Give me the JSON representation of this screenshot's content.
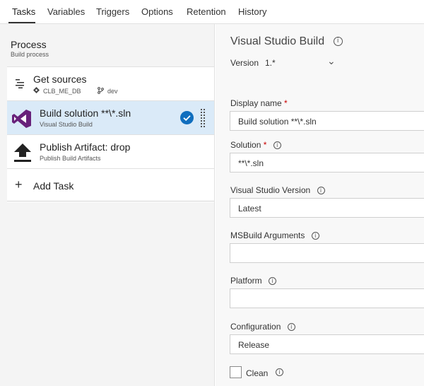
{
  "tabs": [
    {
      "label": "Tasks",
      "active": true
    },
    {
      "label": "Variables"
    },
    {
      "label": "Triggers"
    },
    {
      "label": "Options"
    },
    {
      "label": "Retention"
    },
    {
      "label": "History"
    }
  ],
  "process": {
    "title": "Process",
    "subtitle": "Build process"
  },
  "tasks": [
    {
      "title": "Get sources",
      "repo": "CLB_ME_DB",
      "branch": "dev",
      "icon": "get-sources-icon"
    },
    {
      "title": "Build solution **\\*.sln",
      "subtitle": "Visual Studio Build",
      "icon": "visual-studio-icon",
      "selected": true
    },
    {
      "title": "Publish Artifact: drop",
      "subtitle": "Publish Build Artifacts",
      "icon": "upload-icon"
    }
  ],
  "add_task": {
    "label": "Add Task"
  },
  "details": {
    "title": "Visual Studio Build",
    "version_label": "Version",
    "version_value": "1.*",
    "fields": {
      "display_name": {
        "label": "Display name",
        "value": "Build solution **\\*.sln"
      },
      "solution": {
        "label": "Solution",
        "value": "**\\*.sln"
      },
      "vs_version": {
        "label": "Visual Studio Version",
        "value": "Latest"
      },
      "msbuild_args": {
        "label": "MSBuild Arguments",
        "value": ""
      },
      "platform": {
        "label": "Platform",
        "value": ""
      },
      "configuration": {
        "label": "Configuration",
        "value": "Release"
      }
    },
    "clean": {
      "label": "Clean",
      "checked": false
    }
  },
  "colors": {
    "selected_row": "#daeaf8",
    "check_badge": "#106ebe",
    "vs_purple": "#68217a",
    "required": "#c80000"
  }
}
